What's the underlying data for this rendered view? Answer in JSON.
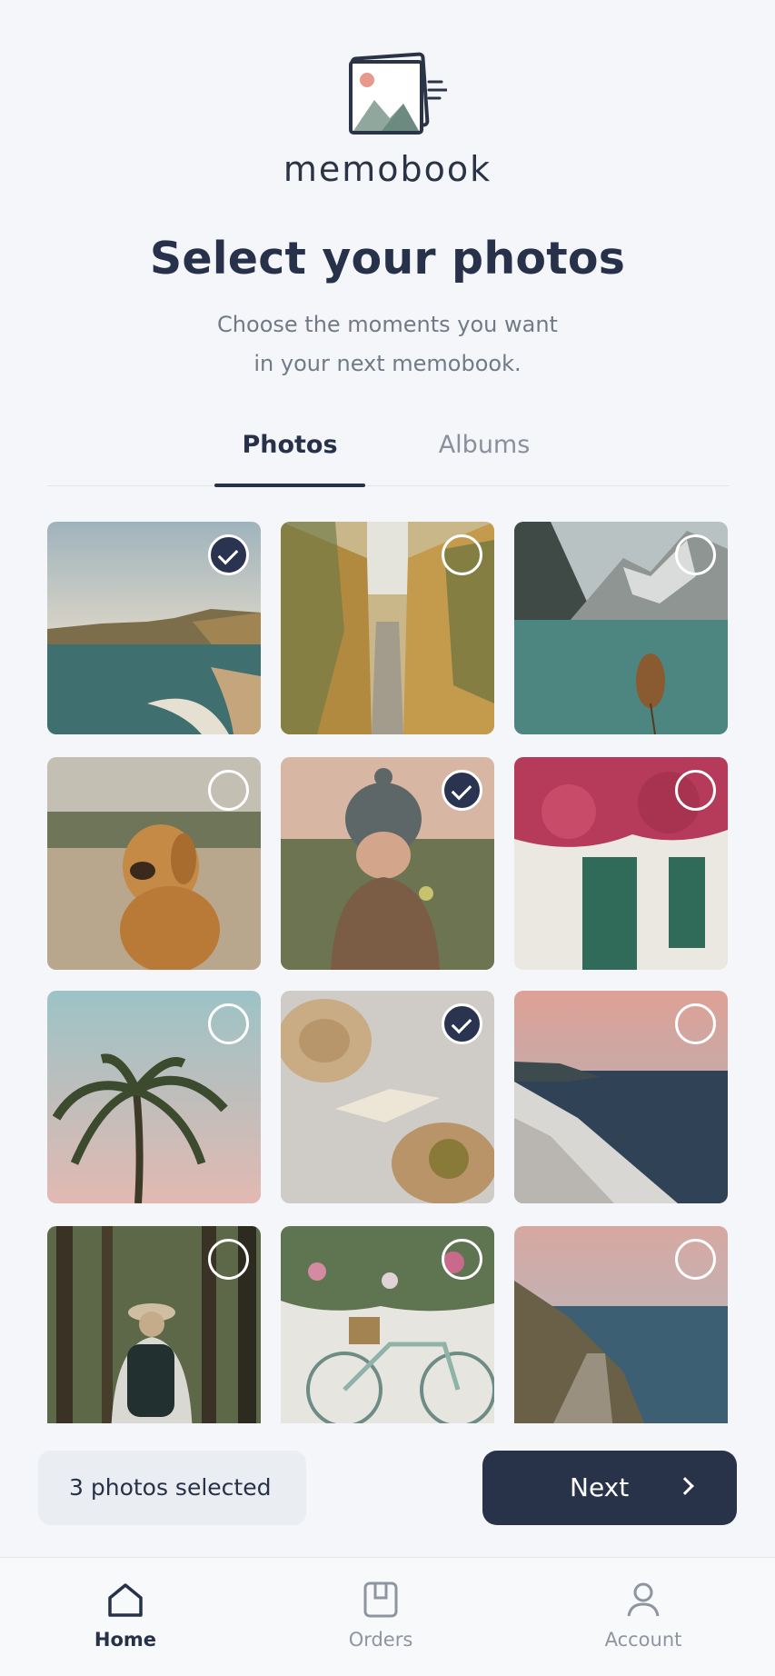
{
  "brand": {
    "name": "memobook"
  },
  "header": {
    "title": "Select your photos",
    "subtitle_line1": "Choose the moments you want",
    "subtitle_line2": "in your next memobook."
  },
  "tabs": [
    {
      "label": "Photos",
      "active": true
    },
    {
      "label": "Albums",
      "active": false
    }
  ],
  "photos": [
    {
      "subject": "coastal cliffs and sea",
      "selected": true
    },
    {
      "subject": "narrow alley with plants",
      "selected": false
    },
    {
      "subject": "mountain lake with rowboat",
      "selected": false
    },
    {
      "subject": "golden retriever",
      "selected": false
    },
    {
      "subject": "child in knit hat",
      "selected": true
    },
    {
      "subject": "white house with bougainvillea",
      "selected": false
    },
    {
      "subject": "palm tree at dusk",
      "selected": false
    },
    {
      "subject": "straw hat and open book",
      "selected": true
    },
    {
      "subject": "whitewashed village by the sea",
      "selected": false
    },
    {
      "subject": "hiker in forest",
      "selected": false
    },
    {
      "subject": "bicycle by flower wall",
      "selected": false
    },
    {
      "subject": "coastal boardwalk at sunset",
      "selected": false
    }
  ],
  "footer": {
    "selected_count_text": "3 photos selected",
    "next_label": "Next"
  },
  "nav": {
    "home": "Home",
    "orders": "Orders",
    "account": "Account"
  },
  "colors": {
    "primary": "#283349",
    "background": "#f5f6f9",
    "muted_text": "#8a909b"
  }
}
